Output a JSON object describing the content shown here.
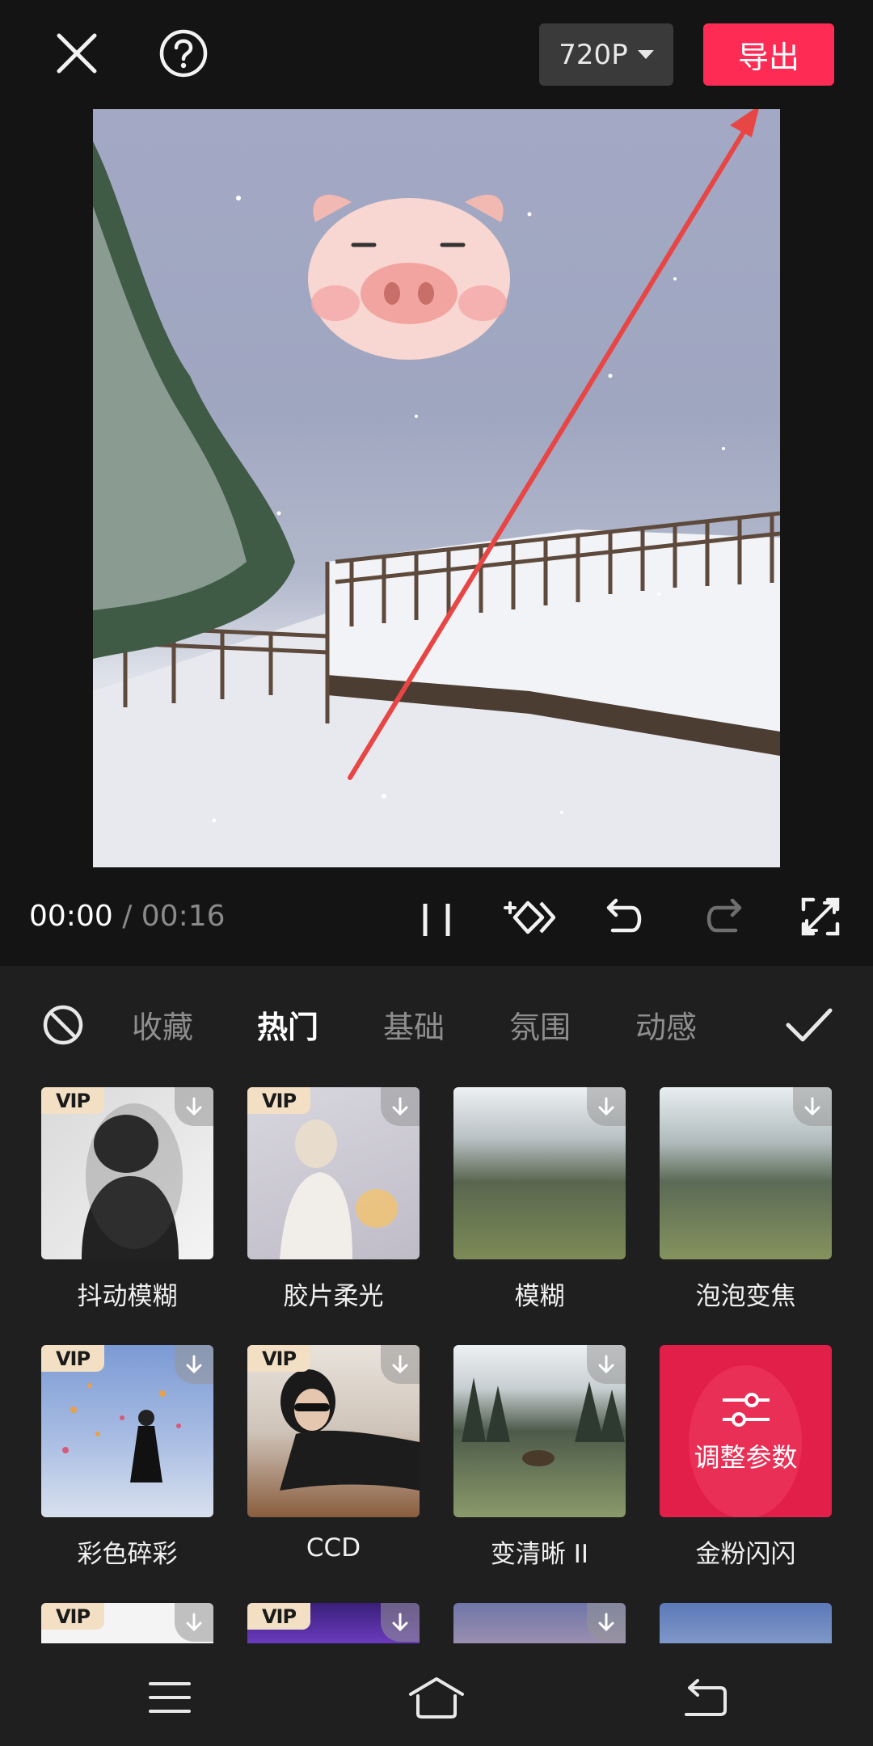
{
  "header": {
    "resolution": "720P",
    "export_label": "导出"
  },
  "player": {
    "current_time": "00:00",
    "separator": " / ",
    "total_time": "00:16"
  },
  "tabs": [
    {
      "label": "收藏"
    },
    {
      "label": "热门",
      "active": true
    },
    {
      "label": "基础"
    },
    {
      "label": "氛围"
    },
    {
      "label": "动感"
    }
  ],
  "effects": [
    {
      "name": "抖动模糊",
      "vip": true,
      "badge": "VIP"
    },
    {
      "name": "胶片柔光",
      "vip": true,
      "badge": "VIP"
    },
    {
      "name": "模糊",
      "vip": false
    },
    {
      "name": "泡泡变焦",
      "vip": false
    },
    {
      "name": "彩色碎彩",
      "vip": true,
      "badge": "VIP"
    },
    {
      "name": "CCD",
      "vip": true,
      "badge": "VIP"
    },
    {
      "name": "变清晰 II",
      "vip": false
    },
    {
      "name": "金粉闪闪",
      "vip": false,
      "selected": true,
      "overlay": "调整参数"
    }
  ],
  "partial_row_badges": [
    "VIP",
    "VIP"
  ],
  "colors": {
    "accent": "#fe2c55",
    "annotation_arrow": "#e84545"
  }
}
